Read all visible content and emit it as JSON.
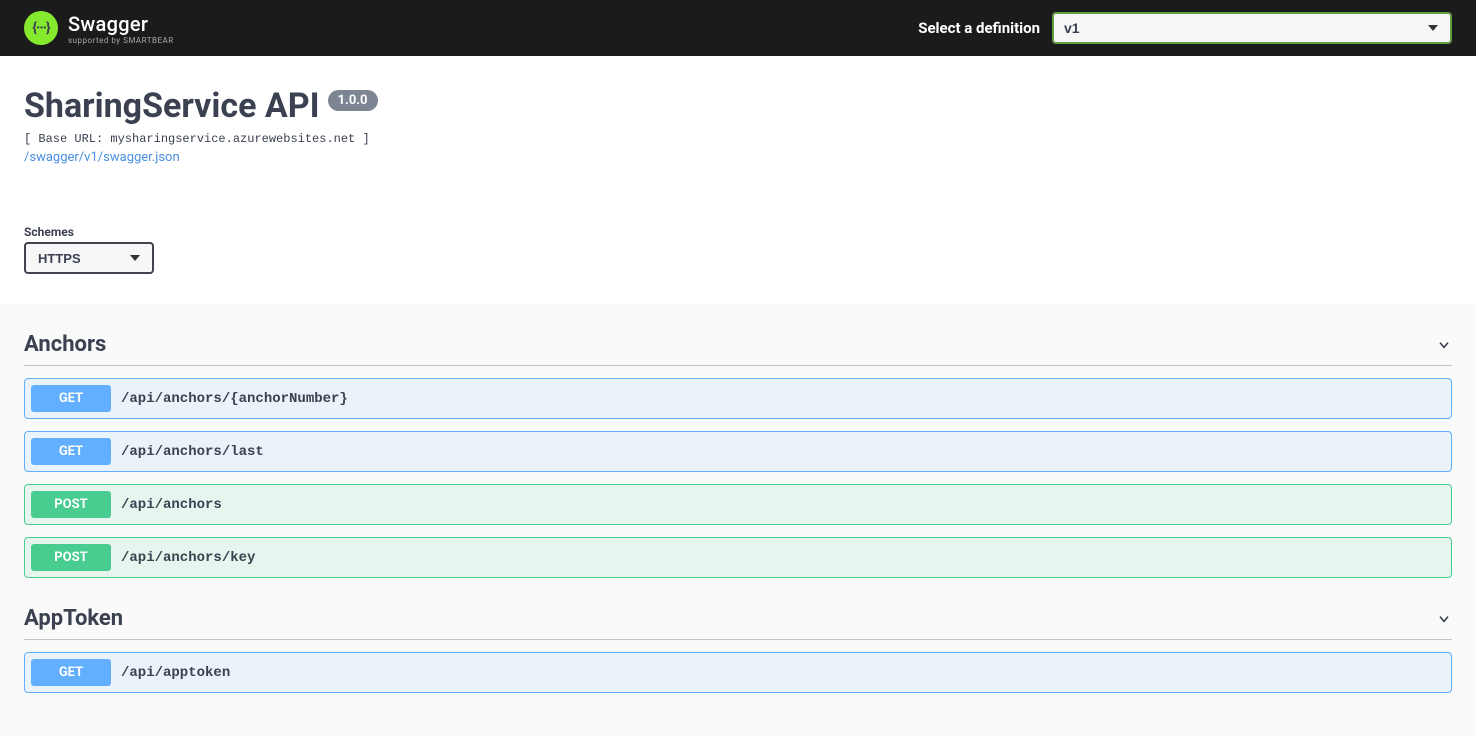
{
  "topbar": {
    "logo_text": "Swagger",
    "logo_sub": "supported by SMARTBEAR",
    "logo_glyph": "{···}",
    "select_label": "Select a definition",
    "definition_value": "v1"
  },
  "info": {
    "title": "SharingService API",
    "version": "1.0.0",
    "base_url": "[ Base URL: mysharingservice.azurewebsites.net ]",
    "json_link": "/swagger/v1/swagger.json"
  },
  "schemes": {
    "label": "Schemes",
    "selected": "HTTPS"
  },
  "tags": [
    {
      "name": "Anchors",
      "ops": [
        {
          "method": "GET",
          "path": "/api/anchors/{anchorNumber}"
        },
        {
          "method": "GET",
          "path": "/api/anchors/last"
        },
        {
          "method": "POST",
          "path": "/api/anchors"
        },
        {
          "method": "POST",
          "path": "/api/anchors/key"
        }
      ]
    },
    {
      "name": "AppToken",
      "ops": [
        {
          "method": "GET",
          "path": "/api/apptoken"
        }
      ]
    }
  ]
}
